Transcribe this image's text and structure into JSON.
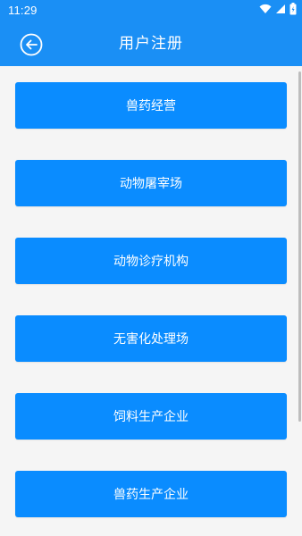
{
  "status_bar": {
    "time": "11:29",
    "icons": [
      "wifi-icon",
      "signal-icon",
      "battery-icon"
    ]
  },
  "header": {
    "title": "用户注册",
    "back_icon": "back-arrow-circle-icon"
  },
  "options": [
    {
      "label": "兽药经营"
    },
    {
      "label": "动物屠宰场"
    },
    {
      "label": "动物诊疗机构"
    },
    {
      "label": "无害化处理场"
    },
    {
      "label": "饲料生产企业"
    },
    {
      "label": "兽药生产企业"
    }
  ],
  "colors": {
    "primary": "#1a8ff5",
    "button": "#0a8cff",
    "background": "#f5f5f5",
    "text_on_primary": "#ffffff"
  }
}
